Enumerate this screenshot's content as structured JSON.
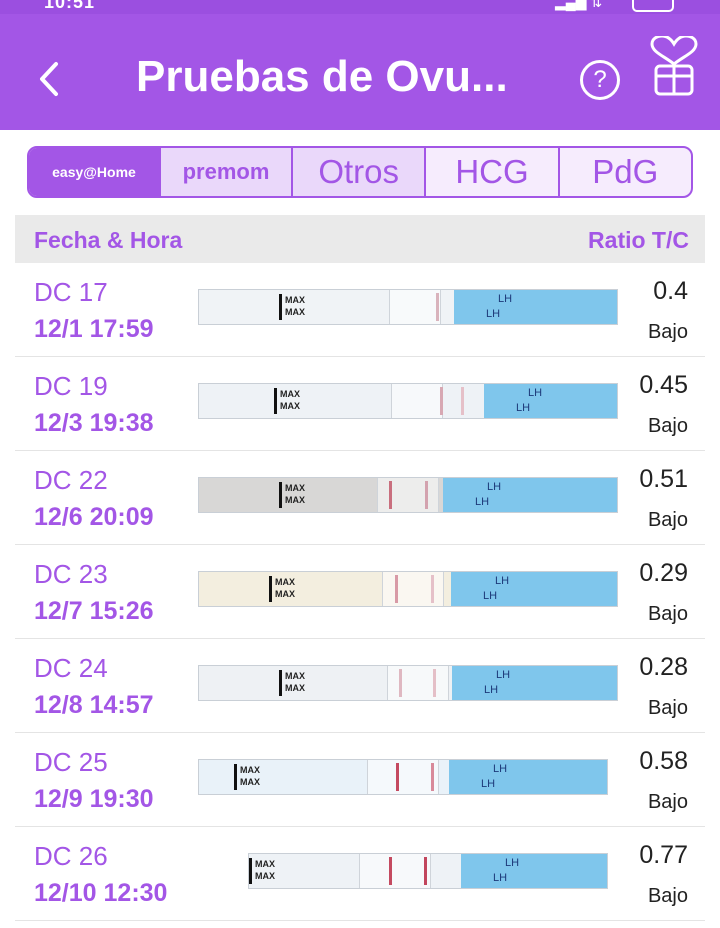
{
  "status_bar": {
    "time": "10:51"
  },
  "header": {
    "title": "Pruebas de Ovu...",
    "help_symbol": "?",
    "back_icon": "chevron-left-icon",
    "heart_icon": "heart-gift-icon"
  },
  "tabs": [
    {
      "label": "easy@Home"
    },
    {
      "label": "premom"
    },
    {
      "label": "Otros"
    },
    {
      "label": "HCG"
    },
    {
      "label": "PdG"
    }
  ],
  "table": {
    "col_left": "Fecha & Hora",
    "col_right": "Ratio T/C",
    "max_label": "MAX",
    "lh_label": "LH",
    "rows": [
      {
        "dc": "DC 17",
        "datetime": "12/1 17:59",
        "ratio": "0.4",
        "level": "Bajo"
      },
      {
        "dc": "DC 19",
        "datetime": "12/3 19:38",
        "ratio": "0.45",
        "level": "Bajo"
      },
      {
        "dc": "DC 22",
        "datetime": "12/6 20:09",
        "ratio": "0.51",
        "level": "Bajo"
      },
      {
        "dc": "DC 23",
        "datetime": "12/7 15:26",
        "ratio": "0.29",
        "level": "Bajo"
      },
      {
        "dc": "DC 24",
        "datetime": "12/8 14:57",
        "ratio": "0.28",
        "level": "Bajo"
      },
      {
        "dc": "DC 25",
        "datetime": "12/9 19:30",
        "ratio": "0.58",
        "level": "Bajo"
      },
      {
        "dc": "DC 26",
        "datetime": "12/10 12:30",
        "ratio": "0.77",
        "level": "Bajo"
      }
    ]
  },
  "colors": {
    "accent": "#a356e6",
    "test_line": "#c9354f",
    "strip_label_blue": "#7fc6ec"
  }
}
